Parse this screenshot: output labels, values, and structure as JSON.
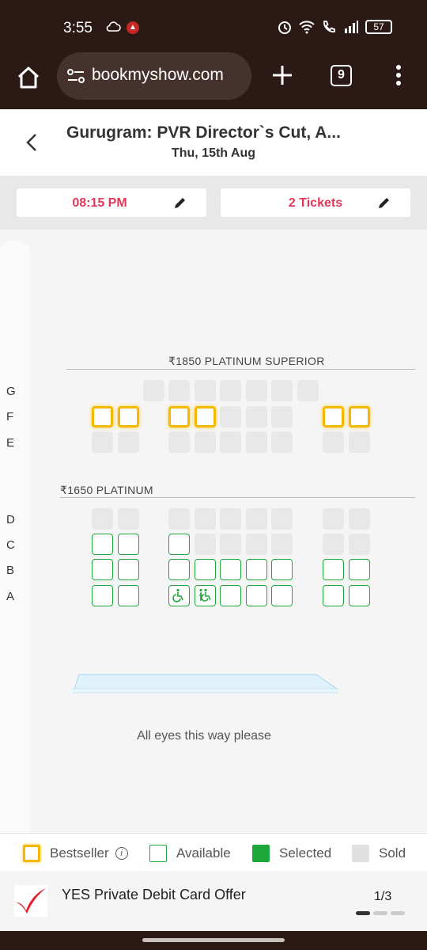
{
  "status_bar": {
    "time": "3:55",
    "battery": "57"
  },
  "browser": {
    "url": "bookmyshow.com",
    "tab_count": "9"
  },
  "header": {
    "title": "Gurugram: PVR Director`s Cut, A...",
    "date": "Thu, 15th Aug"
  },
  "selectors": {
    "time": "08:15 PM",
    "tickets": "2 Tickets"
  },
  "sections": [
    {
      "title": "₹1850 PLATINUM SUPERIOR",
      "rows": [
        "G",
        "F",
        "E"
      ]
    },
    {
      "title": "₹1650 PLATINUM",
      "rows": [
        "D",
        "C",
        "B",
        "A"
      ]
    }
  ],
  "screen_caption": "All eyes this way please",
  "legend": {
    "bestseller": "Bestseller",
    "available": "Available",
    "selected": "Selected",
    "sold": "Sold"
  },
  "offer": {
    "text": "YES Private Debit Card Offer",
    "counter": "1/3"
  },
  "colors": {
    "accent": "#e0385a",
    "available": "#1ea83c",
    "bestseller": "#f5b800",
    "sold": "#e8e8e8",
    "chrome": "#2a1914"
  }
}
